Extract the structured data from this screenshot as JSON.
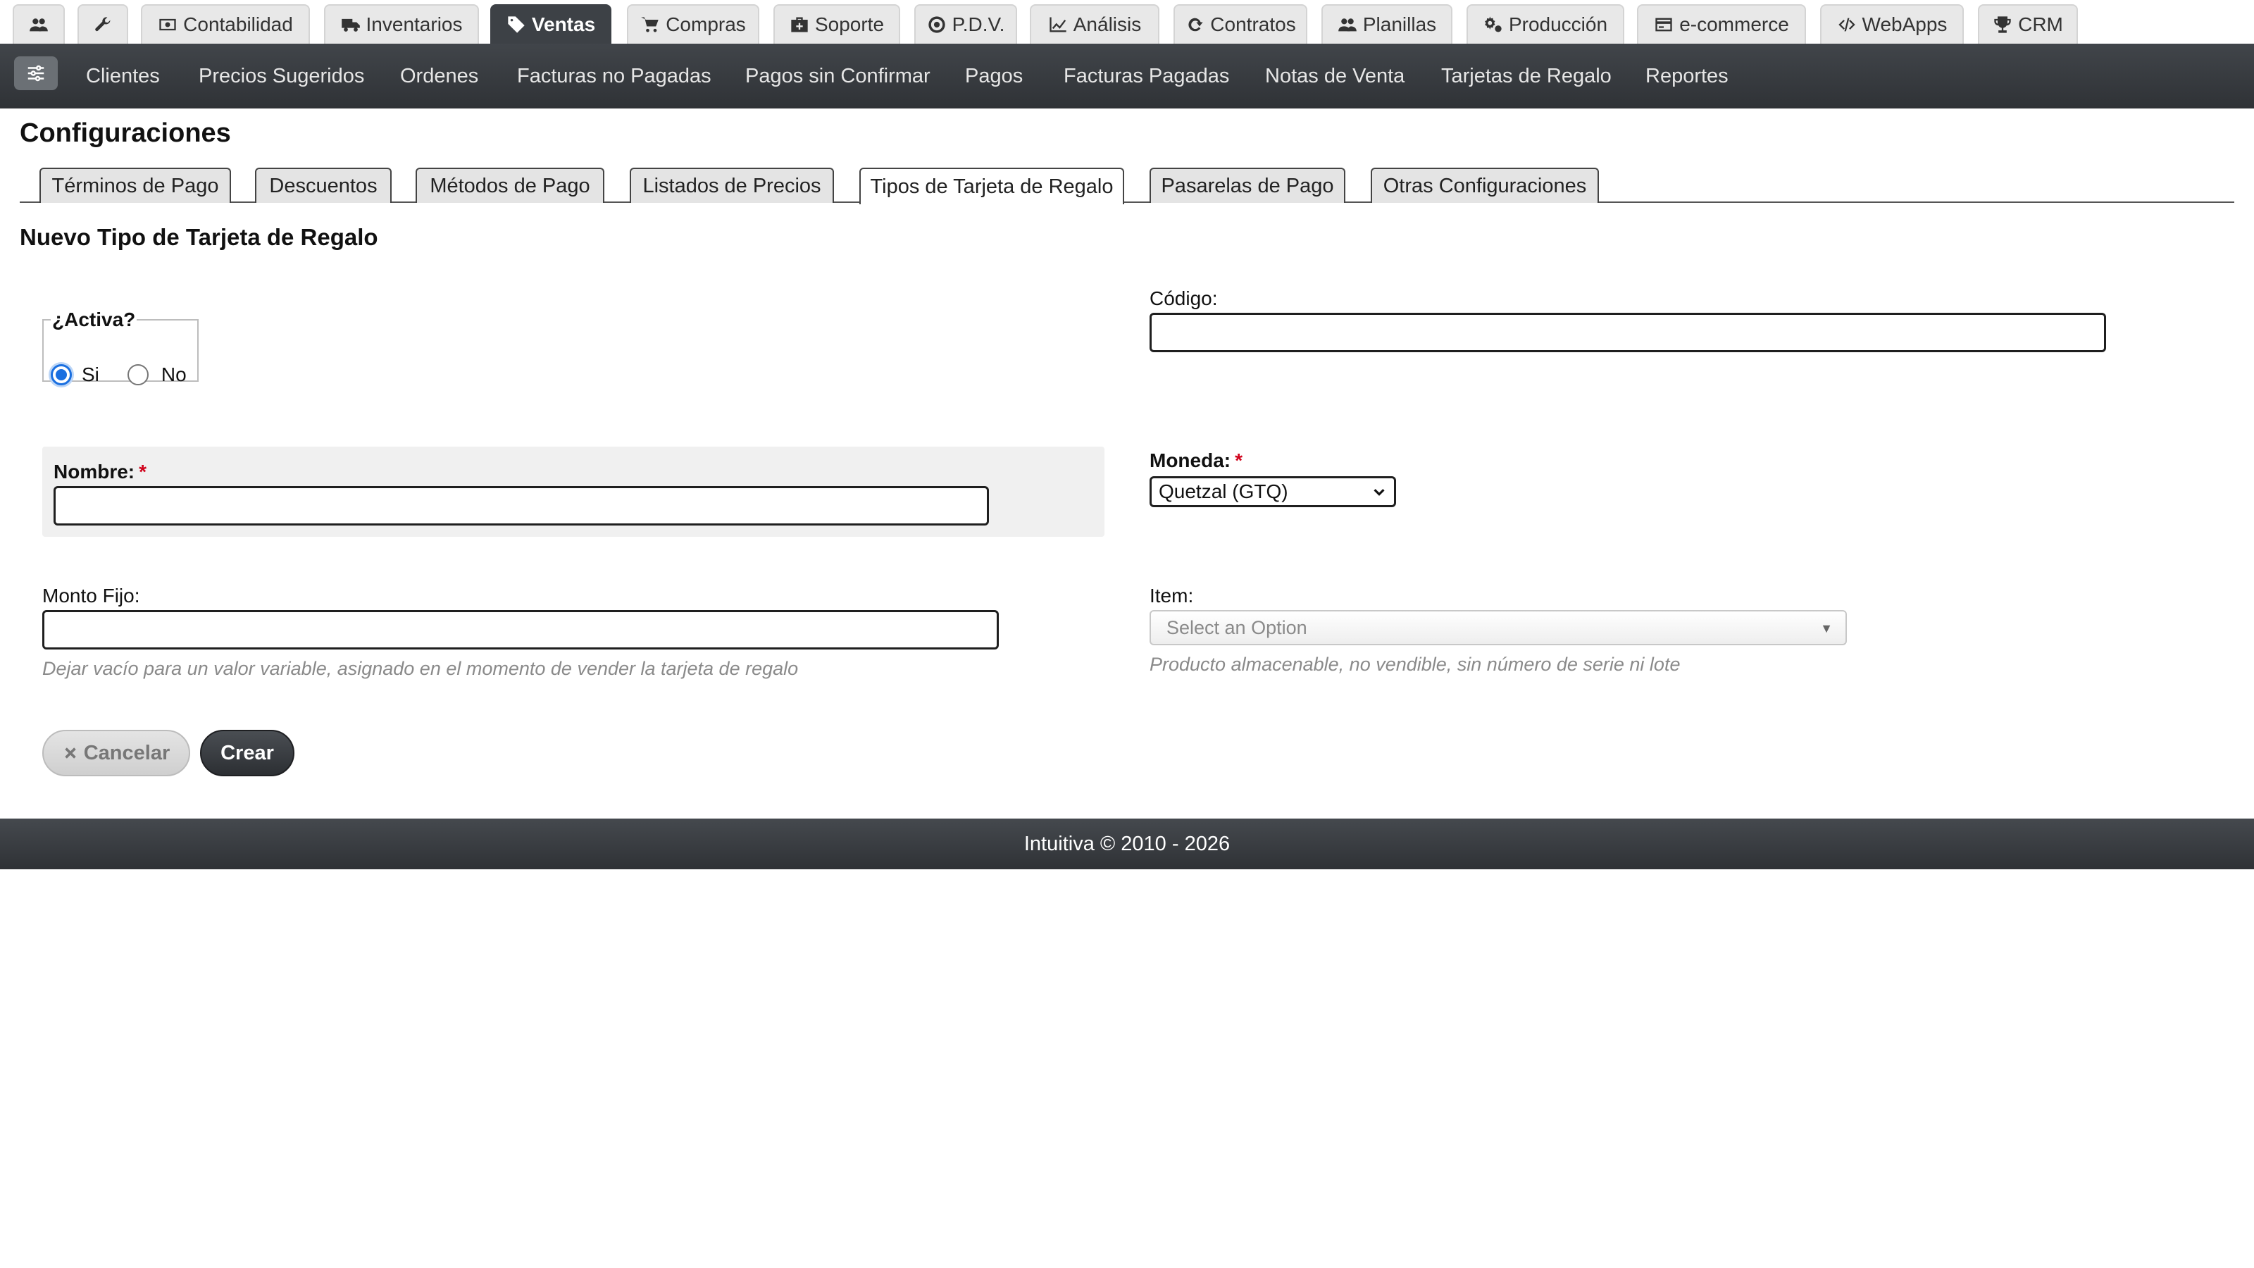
{
  "module_tabs": [
    {
      "label": "",
      "icon": "users-icon"
    },
    {
      "label": "",
      "icon": "wrench-icon"
    },
    {
      "label": "Contabilidad",
      "icon": "money-icon"
    },
    {
      "label": "Inventarios",
      "icon": "truck-icon"
    },
    {
      "label": "Ventas",
      "icon": "tags-icon",
      "active": true
    },
    {
      "label": "Compras",
      "icon": "cart-icon"
    },
    {
      "label": "Soporte",
      "icon": "medkit-icon"
    },
    {
      "label": "P.D.V.",
      "icon": "dot-circle-icon"
    },
    {
      "label": "Análisis",
      "icon": "line-chart-icon"
    },
    {
      "label": "Contratos",
      "icon": "refresh-icon"
    },
    {
      "label": "Planillas",
      "icon": "users-icon"
    },
    {
      "label": "Producción",
      "icon": "cogs-icon"
    },
    {
      "label": "e-commerce",
      "icon": "credit-card-icon"
    },
    {
      "label": "WebApps",
      "icon": "code-icon"
    },
    {
      "label": "CRM",
      "icon": "trophy-icon"
    }
  ],
  "submenu": {
    "toggle_icon": "sliders-icon",
    "items": [
      "Clientes",
      "Precios Sugeridos",
      "Ordenes",
      "Facturas no Pagadas",
      "Pagos sin Confirmar",
      "Pagos",
      "Facturas Pagadas",
      "Notas de Venta",
      "Tarjetas de Regalo",
      "Reportes"
    ]
  },
  "page_title": "Configuraciones",
  "config_tabs": [
    "Términos de Pago",
    "Descuentos",
    "Métodos de Pago",
    "Listados de Precios",
    "Tipos de Tarjeta de Regalo",
    "Pasarelas de Pago",
    "Otras Configuraciones"
  ],
  "active_config_tab": "Tipos de Tarjeta de Regalo",
  "section_title": "Nuevo Tipo de Tarjeta de Regalo",
  "form": {
    "activa": {
      "legend": "¿Activa?",
      "yes_label": "Si",
      "no_label": "No",
      "selected": "Si"
    },
    "codigo": {
      "label": "Código:",
      "value": ""
    },
    "nombre": {
      "label": "Nombre:",
      "required_mark": "*",
      "value": ""
    },
    "moneda": {
      "label": "Moneda:",
      "required_mark": "*",
      "selected": "Quetzal (GTQ)"
    },
    "monto_fijo": {
      "label": "Monto Fijo:",
      "value": "",
      "help": "Dejar vacío para un valor variable, asignado en el momento de vender la tarjeta de regalo"
    },
    "item": {
      "label": "Item:",
      "placeholder": "Select an Option",
      "help": "Producto almacenable, no vendible, sin número de serie ni lote"
    }
  },
  "buttons": {
    "cancel_label": "Cancelar",
    "cancel_icon": "close-icon",
    "create_label": "Crear"
  },
  "footer": {
    "text": "Intuitiva © 2010 - 2026"
  },
  "colors": {
    "active_tab": "#3d4146",
    "required": "#d0021b",
    "radio_checked": "#1a6fe0",
    "submenu_bg": "#3a3e42"
  }
}
